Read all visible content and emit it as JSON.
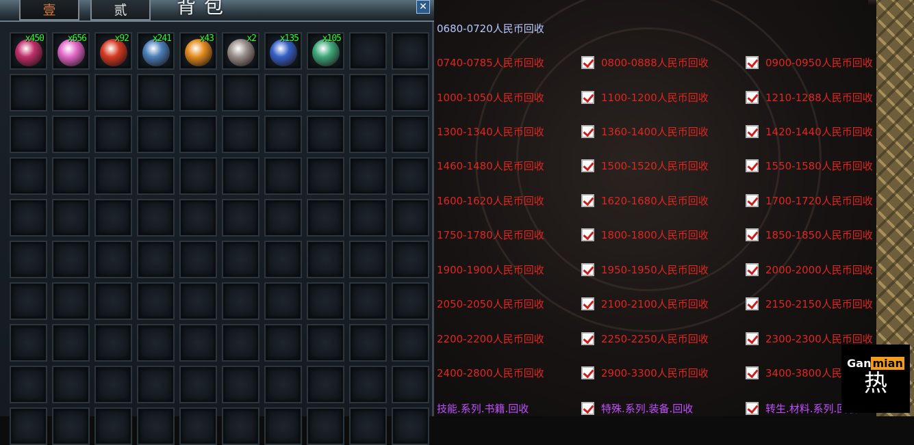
{
  "bag": {
    "tab1_label": "壹",
    "tab2_label": "贰",
    "title": "背包",
    "close_glyph": "✕",
    "items": [
      {
        "qty": "x450",
        "icon": "red-crystal-icon",
        "color": "#c0306a"
      },
      {
        "qty": "x656",
        "icon": "pink-flower-icon",
        "color": "#e266c8"
      },
      {
        "qty": "x92",
        "icon": "red-orb-icon",
        "color": "#d63a23"
      },
      {
        "qty": "x241",
        "icon": "gold-box-icon",
        "color": "#4a7fb8"
      },
      {
        "qty": "x43",
        "icon": "fire-orb-icon",
        "color": "#e48b1e"
      },
      {
        "qty": "x2",
        "icon": "skull-icon",
        "color": "#9a8f8a"
      },
      {
        "qty": "x135",
        "icon": "scroll-icon",
        "color": "#3360c8"
      },
      {
        "qty": "x105",
        "icon": "jade-leaf-icon",
        "color": "#3ea87a"
      }
    ]
  },
  "recycle": {
    "rows": [
      {
        "cells": [
          {
            "text": "0680-0720人民币回收",
            "checked": false,
            "style": "blue"
          }
        ]
      },
      {
        "cells": [
          {
            "text": "0740-0785人民币回收",
            "checked": false,
            "style": "red"
          },
          {
            "text": "0800-0888人民币回收",
            "checked": true,
            "style": "red"
          },
          {
            "text": "0900-0950人民币回收",
            "checked": true,
            "style": "red"
          }
        ]
      },
      {
        "cells": [
          {
            "text": "1000-1050人民币回收",
            "checked": false,
            "style": "red"
          },
          {
            "text": "1100-1200人民币回收",
            "checked": true,
            "style": "red"
          },
          {
            "text": "1210-1288人民币回收",
            "checked": true,
            "style": "red"
          }
        ]
      },
      {
        "cells": [
          {
            "text": "1300-1340人民币回收",
            "checked": false,
            "style": "red"
          },
          {
            "text": "1360-1400人民币回收",
            "checked": true,
            "style": "red"
          },
          {
            "text": "1420-1440人民币回收",
            "checked": true,
            "style": "red"
          }
        ]
      },
      {
        "cells": [
          {
            "text": "1460-1480人民币回收",
            "checked": false,
            "style": "red"
          },
          {
            "text": "1500-1520人民币回收",
            "checked": true,
            "style": "red"
          },
          {
            "text": "1550-1580人民币回收",
            "checked": true,
            "style": "red"
          }
        ]
      },
      {
        "cells": [
          {
            "text": "1600-1620人民币回收",
            "checked": false,
            "style": "red"
          },
          {
            "text": "1620-1680人民币回收",
            "checked": true,
            "style": "red"
          },
          {
            "text": "1700-1720人民币回收",
            "checked": true,
            "style": "red"
          }
        ]
      },
      {
        "cells": [
          {
            "text": "1750-1780人民币回收",
            "checked": false,
            "style": "red"
          },
          {
            "text": "1800-1800人民币回收",
            "checked": true,
            "style": "red"
          },
          {
            "text": "1850-1850人民币回收",
            "checked": true,
            "style": "red"
          }
        ]
      },
      {
        "cells": [
          {
            "text": "1900-1900人民币回收",
            "checked": false,
            "style": "red"
          },
          {
            "text": "1950-1950人民币回收",
            "checked": true,
            "style": "red"
          },
          {
            "text": "2000-2000人民币回收",
            "checked": true,
            "style": "red"
          }
        ]
      },
      {
        "cells": [
          {
            "text": "2050-2050人民币回收",
            "checked": false,
            "style": "red"
          },
          {
            "text": "2100-2100人民币回收",
            "checked": true,
            "style": "red"
          },
          {
            "text": "2150-2150人民币回收",
            "checked": true,
            "style": "red"
          }
        ]
      },
      {
        "cells": [
          {
            "text": "2200-2200人民币回收",
            "checked": false,
            "style": "red"
          },
          {
            "text": "2250-2250人民币回收",
            "checked": true,
            "style": "red"
          },
          {
            "text": "2300-2300人民币回收",
            "checked": true,
            "style": "red"
          }
        ]
      },
      {
        "cells": [
          {
            "text": "2400-2800人民币回收",
            "checked": false,
            "style": "red"
          },
          {
            "text": "2900-3300人民币回收",
            "checked": true,
            "style": "red"
          },
          {
            "text": "3400-3800人民币回收",
            "checked": true,
            "style": "red"
          }
        ]
      },
      {
        "cells": [
          {
            "text": "技能.系列.书籍.回收",
            "checked": false,
            "style": "purple"
          },
          {
            "text": "特殊.系列.装备.回收",
            "checked": true,
            "style": "purple"
          },
          {
            "text": "转生.材料.系列.回收",
            "checked": true,
            "style": "purple"
          }
        ]
      }
    ]
  },
  "watermark": {
    "gan": "Gan",
    "mian": "mian",
    "char": "热"
  },
  "colors": {
    "red_text": "#e0261f",
    "purple_text": "#c24dff",
    "qty_green": "#2cff2c"
  }
}
